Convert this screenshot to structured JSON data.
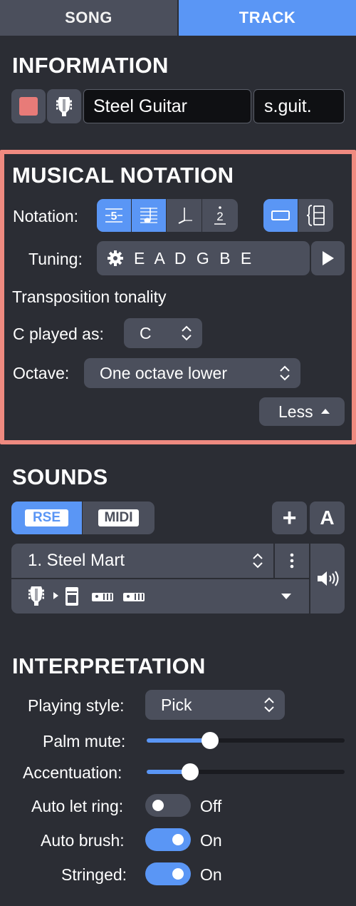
{
  "tabs": {
    "song": "SONG",
    "track": "TRACK"
  },
  "information": {
    "title": "INFORMATION",
    "track_color": "#e87b78",
    "track_name": "Steel Guitar",
    "short_name": "s.guit."
  },
  "musical_notation": {
    "title": "MUSICAL NOTATION",
    "notation_label": "Notation:",
    "tuning_label": "Tuning:",
    "tuning_value": "E A D G B E",
    "transposition_heading": "Transposition tonality",
    "c_played_as_label": "C played as:",
    "c_played_as_value": "C",
    "octave_label": "Octave:",
    "octave_value": "One octave lower",
    "less_button": "Less"
  },
  "sounds": {
    "title": "SOUNDS",
    "rse_label": "RSE",
    "midi_label": "MIDI",
    "add_label": "+",
    "auto_label": "A",
    "sound_name": "1. Steel Mart"
  },
  "interpretation": {
    "title": "INTERPRETATION",
    "playing_style_label": "Playing style:",
    "playing_style_value": "Pick",
    "palm_mute_label": "Palm mute:",
    "palm_mute_level": 0.32,
    "accentuation_label": "Accentuation:",
    "accentuation_level": 0.22,
    "auto_let_ring_label": "Auto let ring:",
    "auto_let_ring_state": "Off",
    "auto_brush_label": "Auto brush:",
    "auto_brush_state": "On",
    "stringed_label": "Stringed:",
    "stringed_state": "On"
  },
  "colors": {
    "accent": "#5a96f5",
    "highlight_border": "#ef8a80",
    "background": "#2b2d34"
  }
}
